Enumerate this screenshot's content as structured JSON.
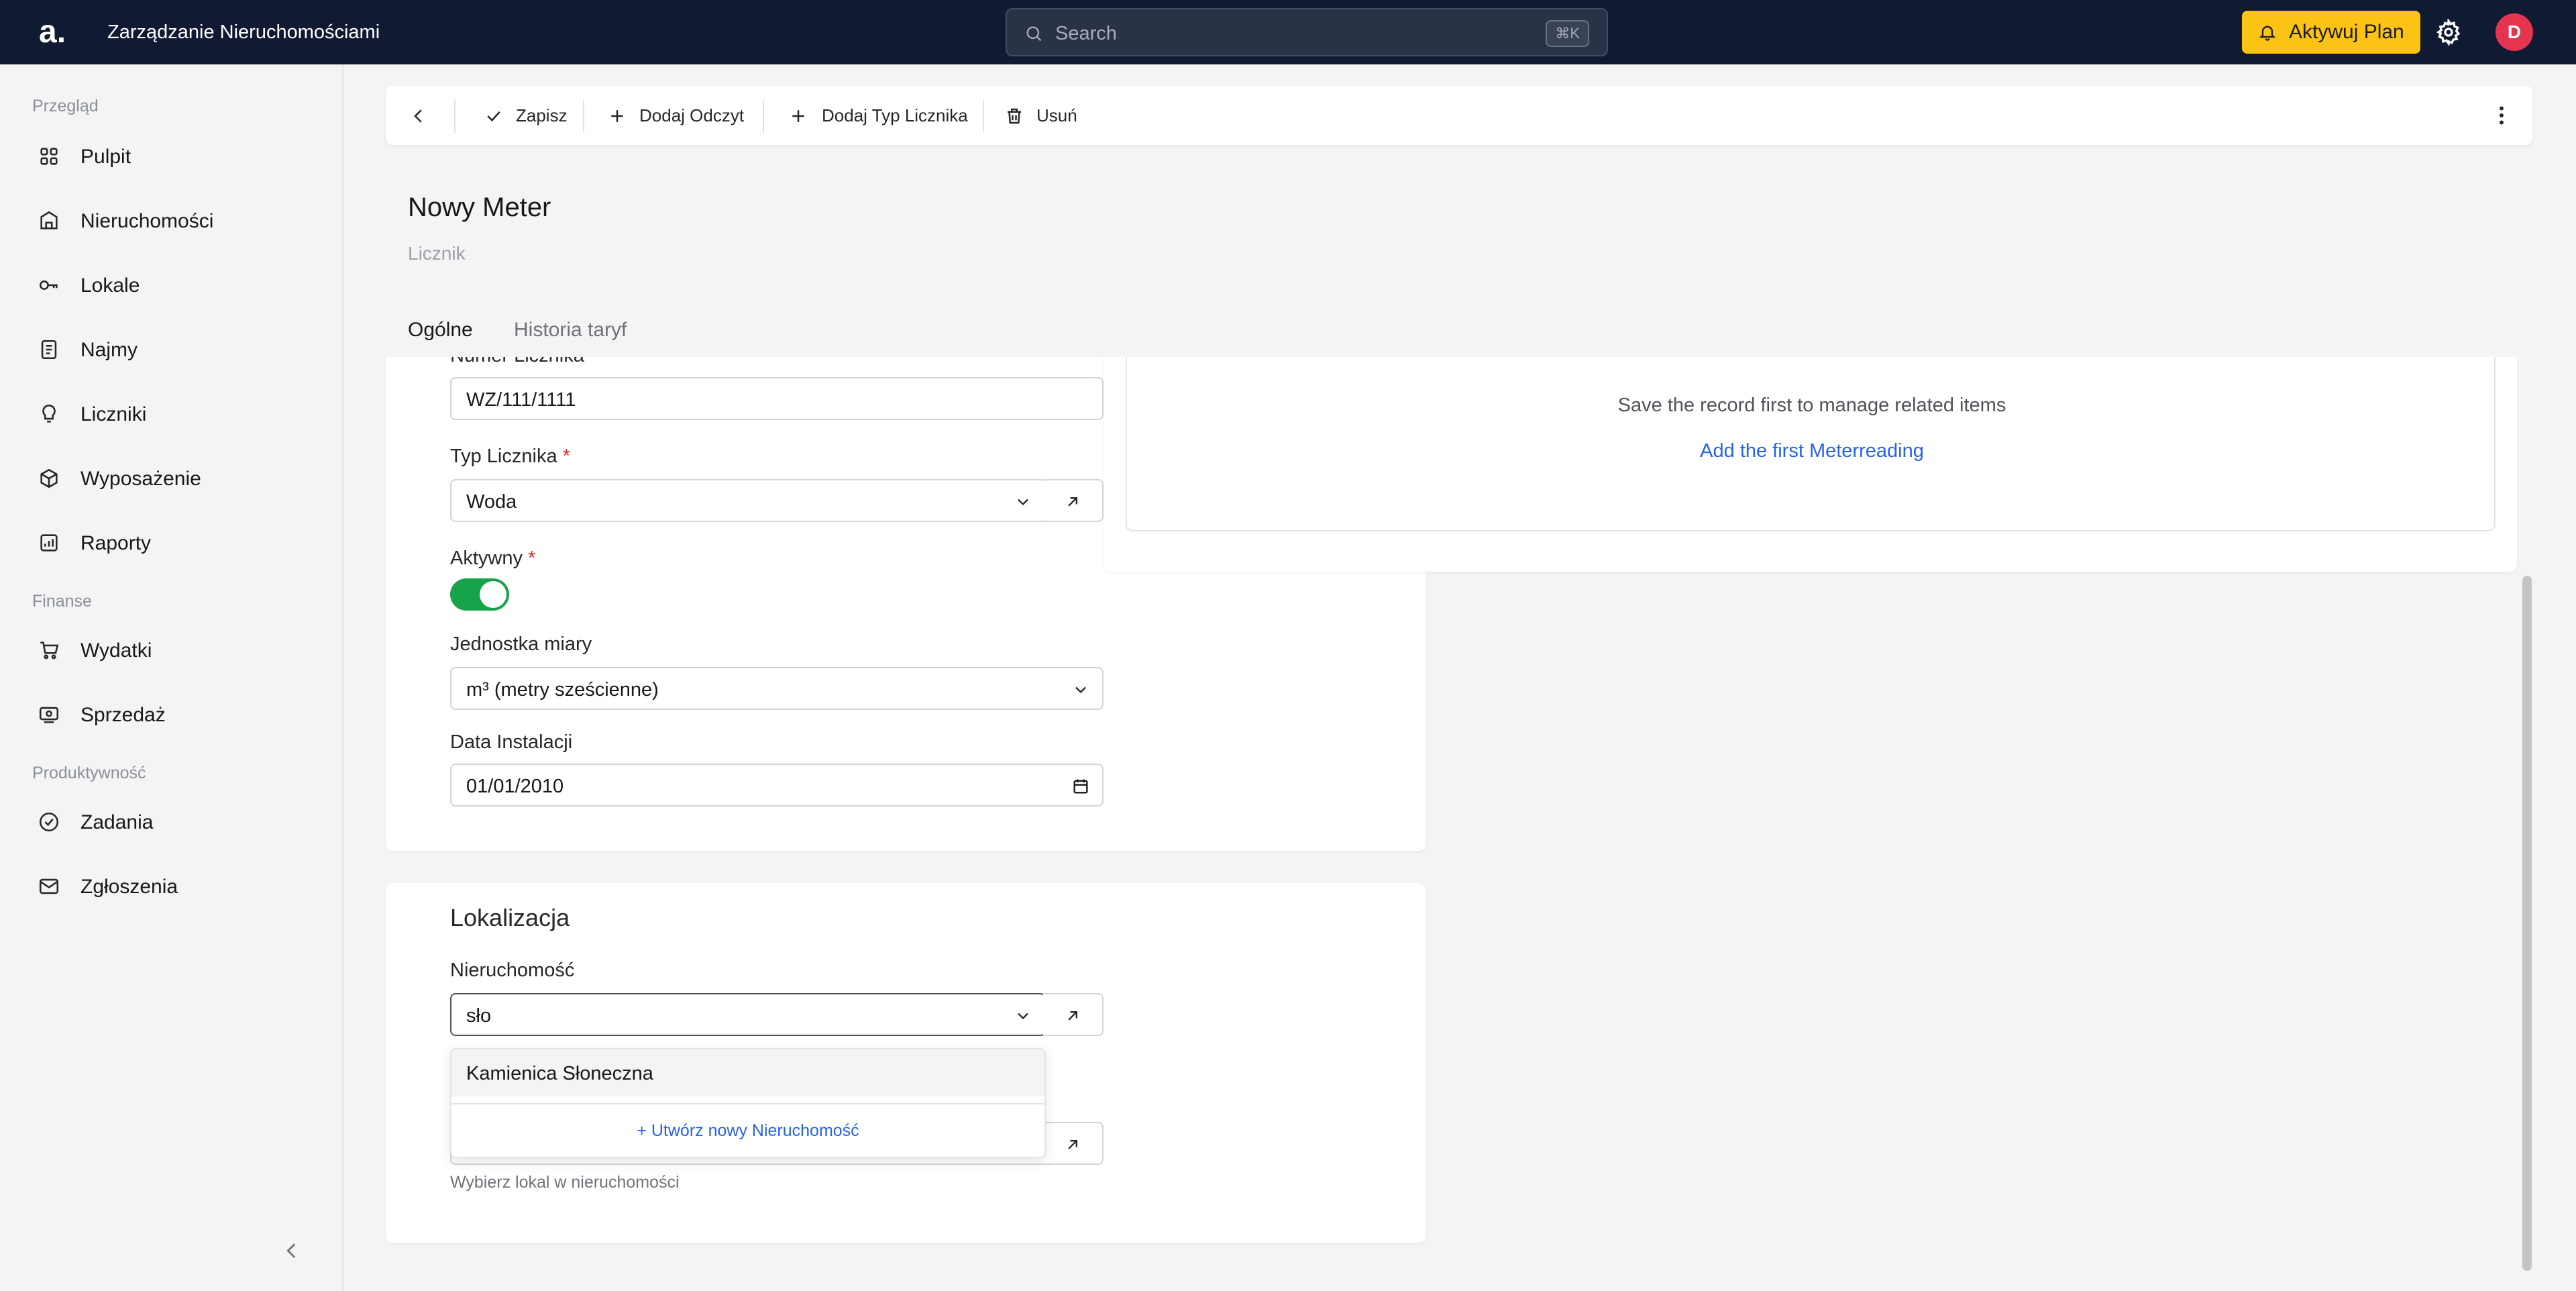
{
  "topbar": {
    "logo": "a.",
    "app_title": "Zarządzanie Nieruchomościami",
    "search_placeholder": "Search",
    "search_shortcut": "⌘K",
    "plan_button": "Aktywuj Plan",
    "avatar_initial": "D"
  },
  "sidebar": {
    "sections": [
      "Przegląd",
      "Finanse",
      "Produktywność"
    ],
    "items": [
      {
        "label": "Pulpit",
        "icon": "grid-icon"
      },
      {
        "label": "Nieruchomości",
        "icon": "building-icon"
      },
      {
        "label": "Lokale",
        "icon": "key-icon"
      },
      {
        "label": "Najmy",
        "icon": "document-icon"
      },
      {
        "label": "Liczniki",
        "icon": "gauge-icon"
      },
      {
        "label": "Wyposażenie",
        "icon": "box-icon"
      },
      {
        "label": "Raporty",
        "icon": "report-icon"
      },
      {
        "label": "Wydatki",
        "icon": "cart-icon"
      },
      {
        "label": "Sprzedaż",
        "icon": "cash-icon"
      },
      {
        "label": "Zadania",
        "icon": "check-circle-icon"
      },
      {
        "label": "Zgłoszenia",
        "icon": "mail-icon"
      }
    ]
  },
  "toolbar": {
    "save": "Zapisz",
    "add_reading": "Dodaj Odczyt",
    "add_meter_type": "Dodaj Typ Licznika",
    "delete": "Usuń"
  },
  "page": {
    "title": "Nowy Meter",
    "subtitle": "Licznik",
    "tabs": [
      "Ogólne",
      "Historia taryf"
    ]
  },
  "form": {
    "meter_number_label": "Numer Licznika",
    "meter_number_value": "WZ/111/1111",
    "meter_type_label": "Typ Licznika",
    "meter_type_value": "Woda",
    "active_label": "Aktywny",
    "active_value": true,
    "unit_label": "Jednostka miary",
    "unit_value": "m³ (metry sześcienne)",
    "install_date_label": "Data Instalacji",
    "install_date_value": "01/01/2010",
    "required_marker": "*"
  },
  "location": {
    "section_title": "Lokalizacja",
    "property_label": "Nieruchomość",
    "property_value": "sło",
    "dropdown_option": "Kamienica Słoneczna",
    "dropdown_create": "+ Utwórz nowy Nieruchomość",
    "unit_help": "Wybierz lokal w nieruchomości"
  },
  "related": {
    "empty_text": "Save the record first to manage related items",
    "add_link": "Add the first Meterreading"
  },
  "colors": {
    "topbar_bg": "#111a33",
    "accent_yellow": "#fbc415",
    "toggle_on": "#16a34a",
    "link_blue": "#2563eb",
    "avatar_red": "#e5344f"
  }
}
